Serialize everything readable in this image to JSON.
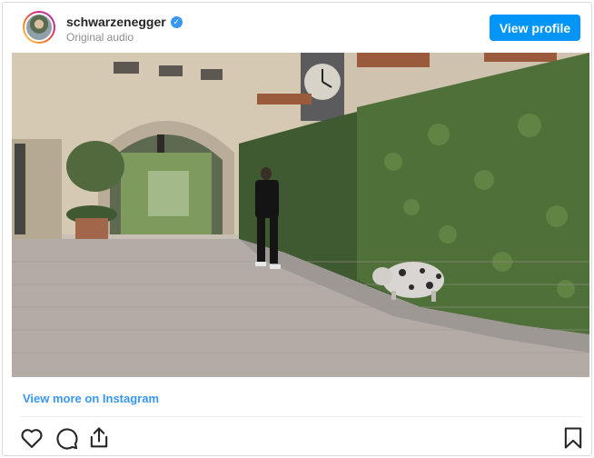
{
  "header": {
    "username": "schwarzenegger",
    "verified": true,
    "subtitle": "Original audio",
    "view_profile_label": "View profile"
  },
  "media": {
    "type": "video-still"
  },
  "footer": {
    "view_more_label": "View more on Instagram",
    "actions": [
      "heart-icon",
      "comment-icon",
      "share-icon",
      "bookmark-icon"
    ]
  },
  "colors": {
    "accent": "#0095f6",
    "link": "#3897f0",
    "verified": "#3897f0",
    "text": "#262626",
    "muted": "#8e8e8e",
    "border": "#dbdbdb"
  }
}
